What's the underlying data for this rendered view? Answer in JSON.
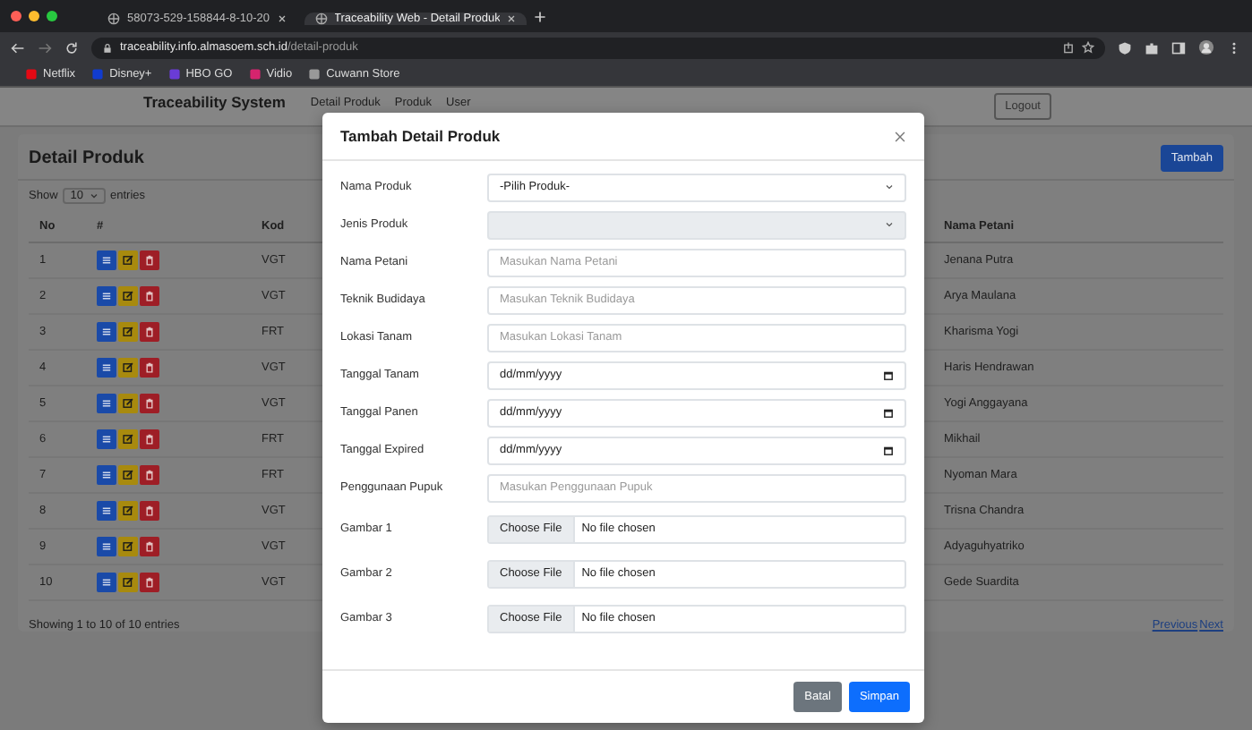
{
  "browser": {
    "tabs": [
      {
        "title": "58073-529-158844-8-10-20",
        "selected": false
      },
      {
        "title": "Traceability Web - Detail Produk",
        "selected": true
      }
    ],
    "address": {
      "host": "traceability.info.almasoem.sch.id",
      "path": "/detail-produk"
    },
    "bookmarks": [
      "Netflix",
      "Disney+",
      "HBO GO",
      "Vidio",
      "Cuwann Store"
    ]
  },
  "navbar": {
    "brand": "Traceability System",
    "links": [
      "Detail Produk",
      "Produk",
      "User"
    ],
    "logout": "Logout"
  },
  "card": {
    "title": "Detail Produk",
    "add_button": "Tambah",
    "length": {
      "show": "Show",
      "value": "10",
      "entries": "entries"
    },
    "table": {
      "columns": [
        "No",
        "#",
        "Kod",
        "Nama Petani"
      ],
      "rows": [
        {
          "no": "1",
          "kode": "VGT",
          "petani": "Jenana Putra"
        },
        {
          "no": "2",
          "kode": "VGT",
          "petani": "Arya Maulana"
        },
        {
          "no": "3",
          "kode": "FRT",
          "petani": "Kharisma Yogi"
        },
        {
          "no": "4",
          "kode": "VGT",
          "petani": "Haris Hendrawan"
        },
        {
          "no": "5",
          "kode": "VGT",
          "petani": "Yogi Anggayana"
        },
        {
          "no": "6",
          "kode": "FRT",
          "petani": "Mikhail"
        },
        {
          "no": "7",
          "kode": "FRT",
          "petani": "Nyoman Mara"
        },
        {
          "no": "8",
          "kode": "VGT",
          "petani": "Trisna Chandra"
        },
        {
          "no": "9",
          "kode": "VGT",
          "petani": "Adyaguhyatriko"
        },
        {
          "no": "10",
          "kode": "VGT",
          "petani": "Gede Suardita"
        }
      ]
    },
    "info": "Showing 1 to 10 of 10 entries",
    "pagination": [
      "Previous",
      "Next"
    ]
  },
  "modal": {
    "title": "Tambah Detail Produk",
    "fields": [
      {
        "label": "Nama Produk",
        "kind": "select",
        "value": "-Pilih Produk-",
        "disabled": false
      },
      {
        "label": "Jenis Produk",
        "kind": "select",
        "disabled": true
      },
      {
        "label": "Nama Petani",
        "kind": "text",
        "placeholder": "Masukan Nama Petani"
      },
      {
        "label": "Teknik Budidaya",
        "kind": "text",
        "placeholder": "Masukan Teknik Budidaya"
      },
      {
        "label": "Lokasi Tanam",
        "kind": "text",
        "placeholder": "Masukan Lokasi Tanam"
      },
      {
        "label": "Tanggal Tanam",
        "kind": "date",
        "value": "dd/mm/yyyy"
      },
      {
        "label": "Tanggal Panen",
        "kind": "date",
        "value": "dd/mm/yyyy"
      },
      {
        "label": "Tanggal Expired",
        "kind": "date",
        "value": "dd/mm/yyyy"
      },
      {
        "label": "Penggunaan Pupuk",
        "kind": "text",
        "placeholder": "Masukan Penggunaan Pupuk"
      },
      {
        "label": "Gambar 1",
        "kind": "file",
        "button": "Choose File",
        "value": "No file chosen"
      },
      {
        "label": "Gambar 2",
        "kind": "file",
        "button": "Choose File",
        "value": "No file chosen"
      },
      {
        "label": "Gambar 3",
        "kind": "file",
        "button": "Choose File",
        "value": "No file chosen"
      }
    ],
    "buttons": [
      {
        "label": "Batal",
        "kind": "secondary"
      },
      {
        "label": "Simpan",
        "kind": "primary"
      }
    ]
  }
}
